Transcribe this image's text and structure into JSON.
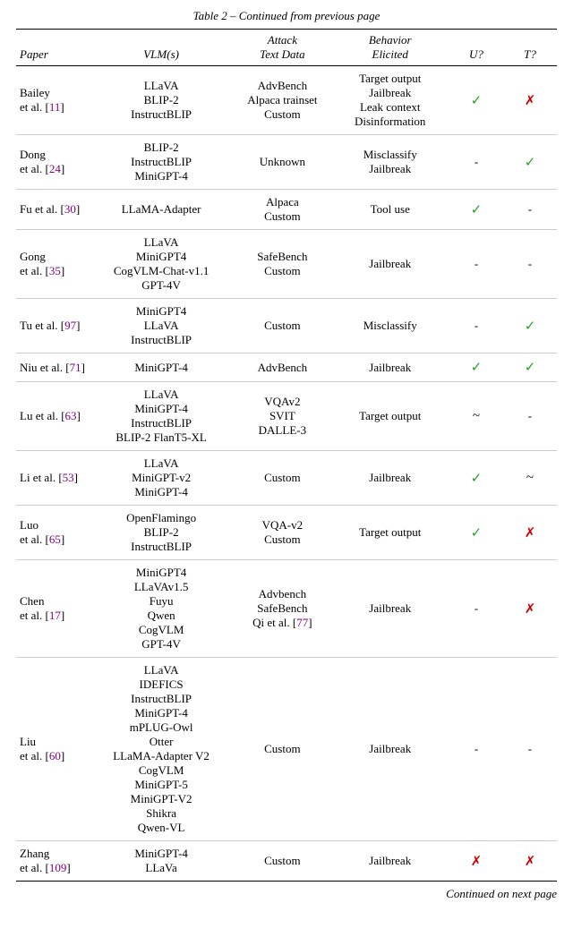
{
  "title": "Table 2 – Continued from previous page",
  "columns": [
    "Paper",
    "VLM(s)",
    "Attack\nText Data",
    "Behavior\nElicited",
    "U?",
    "T?"
  ],
  "rows": [
    {
      "paper": "Bailey\net al. [11]",
      "paper_ref": "11",
      "vlm": "LLaVA\nBLIP-2\nInstructBLIP",
      "attack": "AdvBench\nAlpaca trainset\nCustom",
      "behavior": "Target output\nJailbreak\nLeak context\nDisinformation",
      "u": "check",
      "t": "cross"
    },
    {
      "paper": "Dong\net al. [24]",
      "paper_ref": "24",
      "vlm": "BLIP-2\nInstructBLIP\nMiniGPT-4",
      "attack": "Unknown",
      "behavior": "Misclassify\nJailbreak",
      "u": "dash",
      "t": "check"
    },
    {
      "paper": "Fu et al. [30]",
      "paper_ref": "30",
      "vlm": "LLaMA-Adapter",
      "attack": "Alpaca\nCustom",
      "behavior": "Tool use",
      "u": "check",
      "t": "dash"
    },
    {
      "paper": "Gong\net al. [35]",
      "paper_ref": "35",
      "vlm": "LLaVA\nMiniGPT4\nCogVLM-Chat-v1.1\nGPT-4V",
      "attack": "SafeBench\nCustom",
      "behavior": "Jailbreak",
      "u": "dash",
      "t": "dash"
    },
    {
      "paper": "Tu et al. [97]",
      "paper_ref": "97",
      "vlm": "MiniGPT4\nLLaVA\nInstructBLIP",
      "attack": "Custom",
      "behavior": "Misclassify",
      "u": "dash",
      "t": "check"
    },
    {
      "paper": "Niu et al. [71]",
      "paper_ref": "71",
      "vlm": "MiniGPT-4",
      "attack": "AdvBench",
      "behavior": "Jailbreak",
      "u": "check",
      "t": "check"
    },
    {
      "paper": "Lu et al. [63]",
      "paper_ref": "63",
      "vlm": "LLaVA\nMiniGPT-4\nInstructBLIP\nBLIP-2 FlanT5-XL",
      "attack": "VQAv2\nSVIT\nDALLE-3",
      "behavior": "Target output",
      "u": "tilde",
      "t": "dash"
    },
    {
      "paper": "Li et al. [53]",
      "paper_ref": "53",
      "vlm": "LLaVA\nMiniGPT-v2\nMiniGPT-4",
      "attack": "Custom",
      "behavior": "Jailbreak",
      "u": "check",
      "t": "tilde"
    },
    {
      "paper": "Luo\net al. [65]",
      "paper_ref": "65",
      "vlm": "OpenFlamingo\nBLIP-2\nInstructBLIP",
      "attack": "VQA-v2\nCustom",
      "behavior": "Target output",
      "u": "check",
      "t": "cross"
    },
    {
      "paper": "Chen\net al. [17]",
      "paper_ref": "17",
      "vlm": "MiniGPT4\nLLaVAv1.5\nFuyu\nQwen\nCogVLM\nGPT-4V",
      "attack": "Advbench\nSafeBench\nQi et al. [77]",
      "attack_ref": "77",
      "behavior": "Jailbreak",
      "u": "dash",
      "t": "cross"
    },
    {
      "paper": "Liu\net al. [60]",
      "paper_ref": "60",
      "vlm": "LLaVA\nIDEFICS\nInstructBLIP\nMiniGPT-4\nmPLUG-Owl\nOtter\nLLaMA-Adapter V2\nCogVLM\nMiniGPT-5\nMiniGPT-V2\nShikra\nQwen-VL",
      "attack": "Custom",
      "behavior": "Jailbreak",
      "u": "dash",
      "t": "dash"
    },
    {
      "paper": "Zhang\net al. [109]",
      "paper_ref": "109",
      "vlm": "MiniGPT-4\nLLaVa",
      "attack": "Custom",
      "behavior": "Jailbreak",
      "u": "cross",
      "t": "cross"
    }
  ],
  "continued": "Continued on next page"
}
